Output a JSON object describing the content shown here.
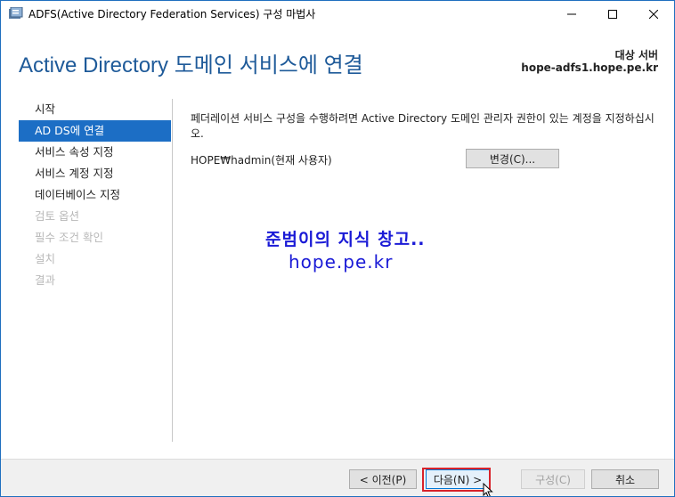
{
  "window": {
    "title": "ADFS(Active Directory Federation Services) 구성 마법사"
  },
  "header": {
    "title": "Active Directory 도메인 서비스에 연결",
    "target_label": "대상 서버",
    "target_host": "hope-adfs1.hope.pe.kr"
  },
  "nav": {
    "items": [
      {
        "label": "시작",
        "state": "normal"
      },
      {
        "label": "AD DS에 연결",
        "state": "active"
      },
      {
        "label": "서비스 속성 지정",
        "state": "normal"
      },
      {
        "label": "서비스 계정 지정",
        "state": "normal"
      },
      {
        "label": "데이터베이스 지정",
        "state": "normal"
      },
      {
        "label": "검토 옵션",
        "state": "disabled"
      },
      {
        "label": "필수 조건 확인",
        "state": "disabled"
      },
      {
        "label": "설치",
        "state": "disabled"
      },
      {
        "label": "결과",
        "state": "disabled"
      }
    ]
  },
  "content": {
    "description": "페더레이션 서비스 구성을 수행하려면 Active Directory 도메인 관리자 권한이 있는 계정을 지정하십시오.",
    "account": "HOPE₩hadmin(현재 사용자)",
    "change_button": "변경(C)..."
  },
  "watermark": {
    "line1": "준범이의 지식 창고..",
    "line2": "hope.pe.kr"
  },
  "footer": {
    "prev_button": "< 이전(P)",
    "next_button": "다음(N) >",
    "install_button": "구성(C)",
    "cancel_button": "취소"
  },
  "colors": {
    "accent": "#1c6ec5",
    "heading": "#1e5a99",
    "highlight": "#d8232a"
  }
}
